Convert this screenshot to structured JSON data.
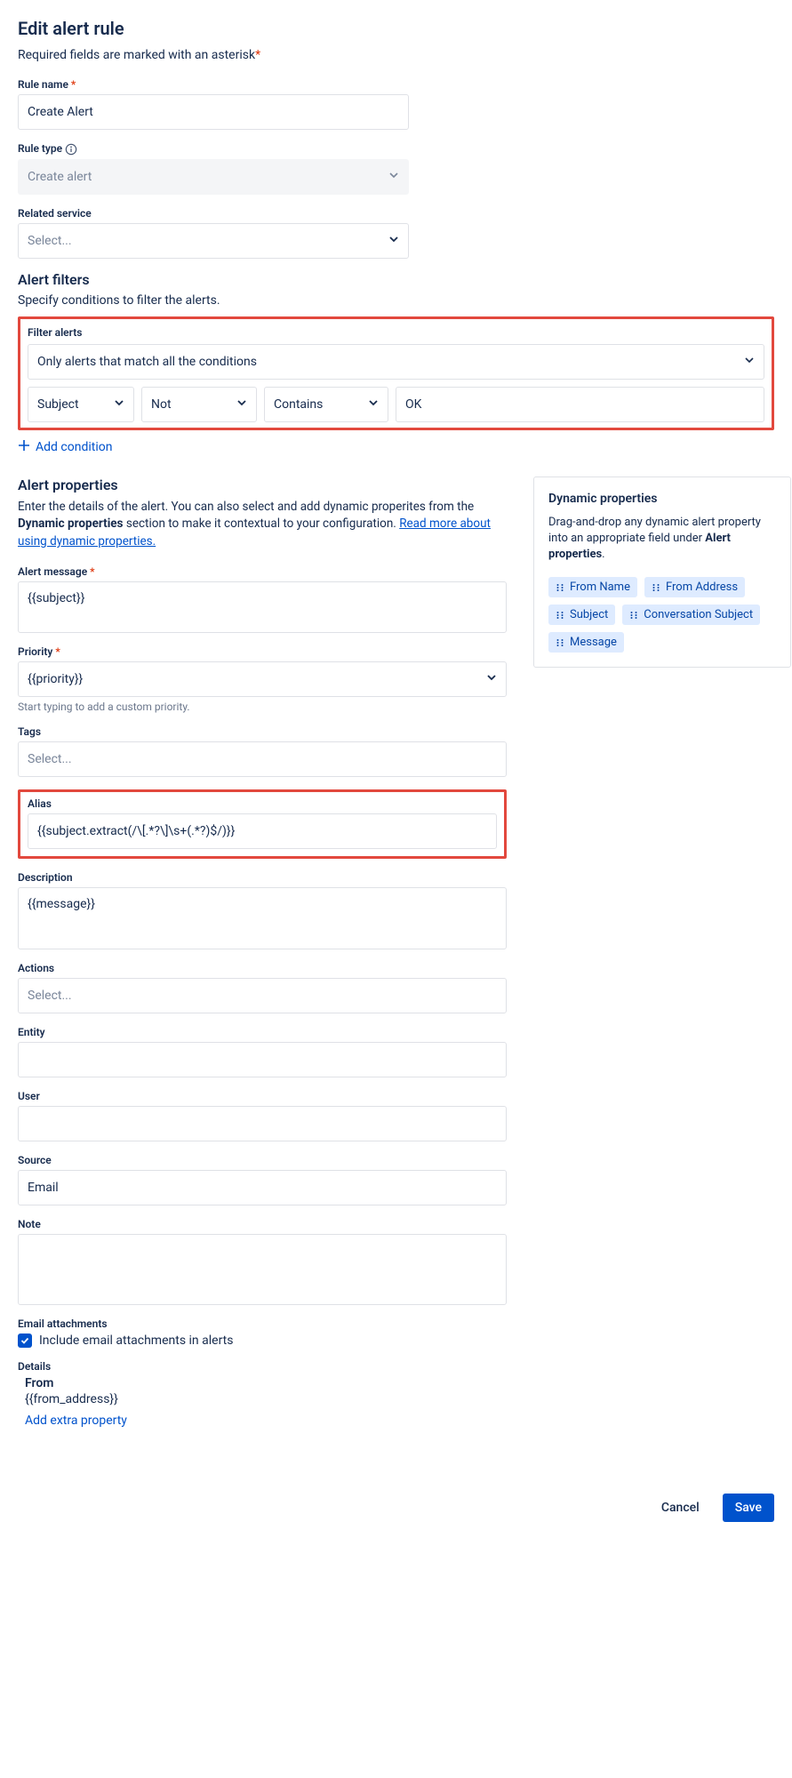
{
  "page": {
    "title": "Edit alert rule",
    "required_note": "Required fields are marked with an asterisk",
    "required_star": "*"
  },
  "rule_name": {
    "label": "Rule name",
    "value": "Create Alert"
  },
  "rule_type": {
    "label": "Rule type",
    "value": "Create alert"
  },
  "related_service": {
    "label": "Related service",
    "placeholder": "Select..."
  },
  "filters": {
    "heading": "Alert filters",
    "subheading": "Specify conditions to filter the alerts.",
    "box_label": "Filter alerts",
    "match_mode": "Only alerts that match all the conditions",
    "cond_field": "Subject",
    "cond_neg": "Not",
    "cond_op": "Contains",
    "cond_value": "OK",
    "add_condition": "Add condition"
  },
  "properties": {
    "heading": "Alert properties",
    "desc1": "Enter the details of the alert. You can also select and add dynamic properites from the ",
    "desc_bold": "Dynamic properties",
    "desc2": " section to make it contextual to your configuration. ",
    "link": "Read more about using dynamic properties.",
    "alert_message": {
      "label": "Alert message",
      "value": "{{subject}}"
    },
    "priority": {
      "label": "Priority",
      "value": "{{priority}}",
      "hint": "Start typing to add a custom priority."
    },
    "tags": {
      "label": "Tags",
      "placeholder": "Select..."
    },
    "alias": {
      "label": "Alias",
      "value": "{{subject.extract(/\\[.*?\\]\\s+(.*?)$/)}}"
    },
    "description": {
      "label": "Description",
      "value": "{{message}}"
    },
    "actions": {
      "label": "Actions",
      "placeholder": "Select..."
    },
    "entity": {
      "label": "Entity",
      "value": ""
    },
    "user": {
      "label": "User",
      "value": ""
    },
    "source": {
      "label": "Source",
      "value": "Email"
    },
    "note": {
      "label": "Note",
      "value": ""
    },
    "attachments": {
      "label": "Email attachments",
      "checkbox_label": "Include email attachments in alerts"
    },
    "details": {
      "label": "Details",
      "key": "From",
      "value": "{{from_address}}",
      "add": "Add extra property"
    }
  },
  "sidebar": {
    "heading": "Dynamic properties",
    "desc1": "Drag-and-drop any dynamic alert property into an appropriate field under ",
    "desc_bold": "Alert properties",
    "desc2": ".",
    "chips": [
      "From Name",
      "From Address",
      "Subject",
      "Conversation Subject",
      "Message"
    ]
  },
  "footer": {
    "cancel": "Cancel",
    "save": "Save"
  }
}
